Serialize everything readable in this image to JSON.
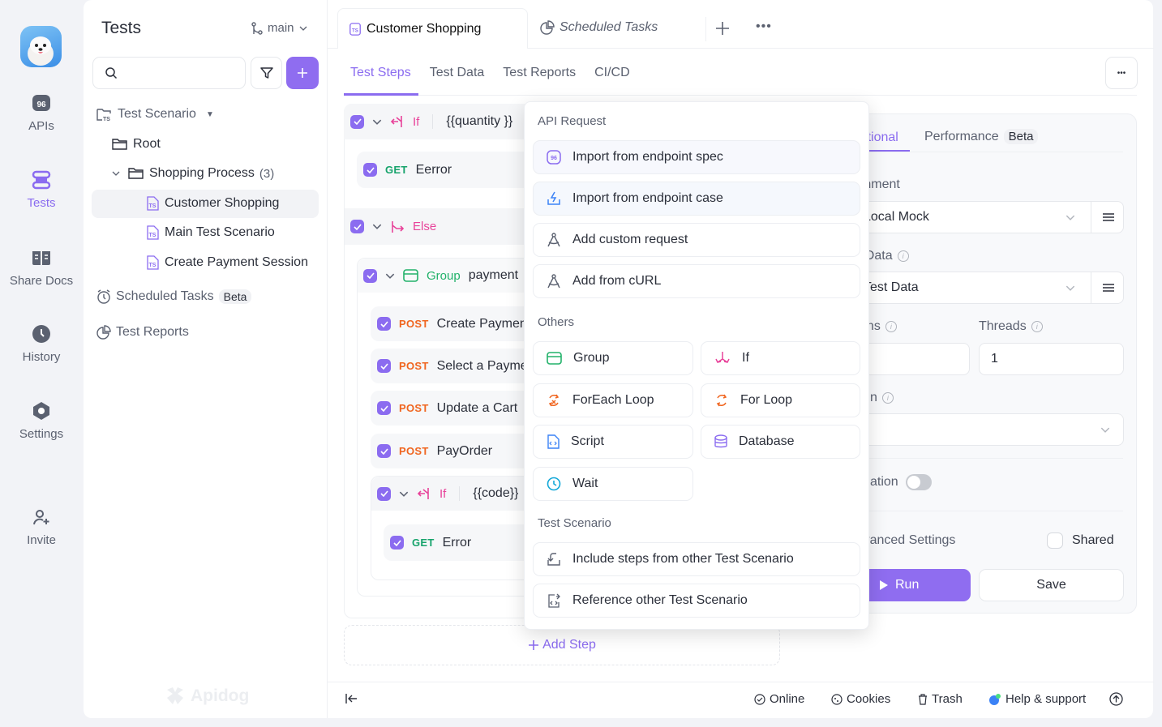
{
  "rail": {
    "items": [
      {
        "label": "APIs",
        "icon": "apis-icon"
      },
      {
        "label": "Tests",
        "icon": "tests-icon",
        "active": true
      },
      {
        "label": "Share Docs",
        "icon": "book-icon"
      },
      {
        "label": "History",
        "icon": "clock-icon"
      },
      {
        "label": "Settings",
        "icon": "gear-icon"
      },
      {
        "label": "Invite",
        "icon": "user-plus-icon"
      }
    ],
    "apis_icon_text": "96"
  },
  "sidebar": {
    "title": "Tests",
    "branch": "main",
    "search_placeholder": "",
    "tree": {
      "scenario_label": "Test Scenario",
      "root": "Root",
      "folder": "Shopping Process",
      "folder_count": "(3)",
      "scenarios": [
        "Customer Shopping",
        "Main Test Scenario",
        "Create Payment Session"
      ],
      "scheduled": "Scheduled Tasks",
      "scheduled_badge": "Beta",
      "reports": "Test Reports"
    },
    "watermark": "Apidog"
  },
  "tabs": {
    "open": [
      {
        "label": "Customer Shopping",
        "active": true
      },
      {
        "label": "Scheduled Tasks",
        "italic": true
      }
    ],
    "sub": [
      "Test Steps",
      "Test Data",
      "Test Reports",
      "CI/CD"
    ],
    "active_sub": "Test Steps"
  },
  "steps": {
    "if1": {
      "label": "If",
      "cond": "{{quantity }}"
    },
    "get1": {
      "method": "GET",
      "name": "Eerror"
    },
    "else": {
      "label": "Else"
    },
    "group": {
      "label": "Group",
      "name": "payment"
    },
    "posts": [
      {
        "method": "POST",
        "name": "Create Payment"
      },
      {
        "method": "POST",
        "name": "Select a Payment"
      },
      {
        "method": "POST",
        "name": "Update a Cart"
      },
      {
        "method": "POST",
        "name": "PayOrder"
      }
    ],
    "if2": {
      "label": "If",
      "cond": "{{code}}"
    },
    "get2": {
      "method": "GET",
      "name": "Error"
    },
    "add_step": "Add Step"
  },
  "popup": {
    "api_section": "API Request",
    "api_items": [
      {
        "label": "Import from endpoint spec",
        "icon": "endpoint-spec-icon"
      },
      {
        "label": "Import from endpoint case",
        "icon": "endpoint-case-icon"
      },
      {
        "label": "Add custom request",
        "icon": "compass-icon"
      },
      {
        "label": "Add from cURL",
        "icon": "compass-icon"
      }
    ],
    "others_section": "Others",
    "others_items": [
      {
        "label": "Group",
        "icon": "group-icon"
      },
      {
        "label": "If",
        "icon": "if-icon"
      },
      {
        "label": "ForEach Loop",
        "icon": "foreach-icon"
      },
      {
        "label": "For Loop",
        "icon": "loop-icon"
      },
      {
        "label": "Script",
        "icon": "script-icon"
      },
      {
        "label": "Database",
        "icon": "database-icon"
      },
      {
        "label": "Wait",
        "icon": "clock-icon"
      }
    ],
    "scenario_section": "Test Scenario",
    "scenario_items": [
      {
        "label": "Include steps from other Test Scenario",
        "icon": "import-icon"
      },
      {
        "label": "Reference other Test Scenario",
        "icon": "reference-icon"
      }
    ]
  },
  "config": {
    "tab_functional": "Functional",
    "tab_performance": "Performance",
    "tab_performance_badge": "Beta",
    "environment_label": "Environment",
    "environment_value": "Local Mock",
    "data_label": "Test Data",
    "data_value": "Test Data",
    "iterations_label": "Iterations",
    "threads_label": "Threads",
    "threads_value": "1",
    "field5_label_fragment": "n",
    "toggle_label_fragment": "ation",
    "toggle_on": false,
    "advanced_label": "Advanced Settings",
    "shared_label": "Shared",
    "shared_checked": false,
    "run": "Run",
    "save": "Save"
  },
  "footer": {
    "online": "Online",
    "cookies": "Cookies",
    "trash": "Trash",
    "help": "Help & support"
  },
  "colors": {
    "accent": "#8b6cf0",
    "get": "#16a36b",
    "post": "#f0651f",
    "control": "#e8439a",
    "group": "#22b26a"
  }
}
